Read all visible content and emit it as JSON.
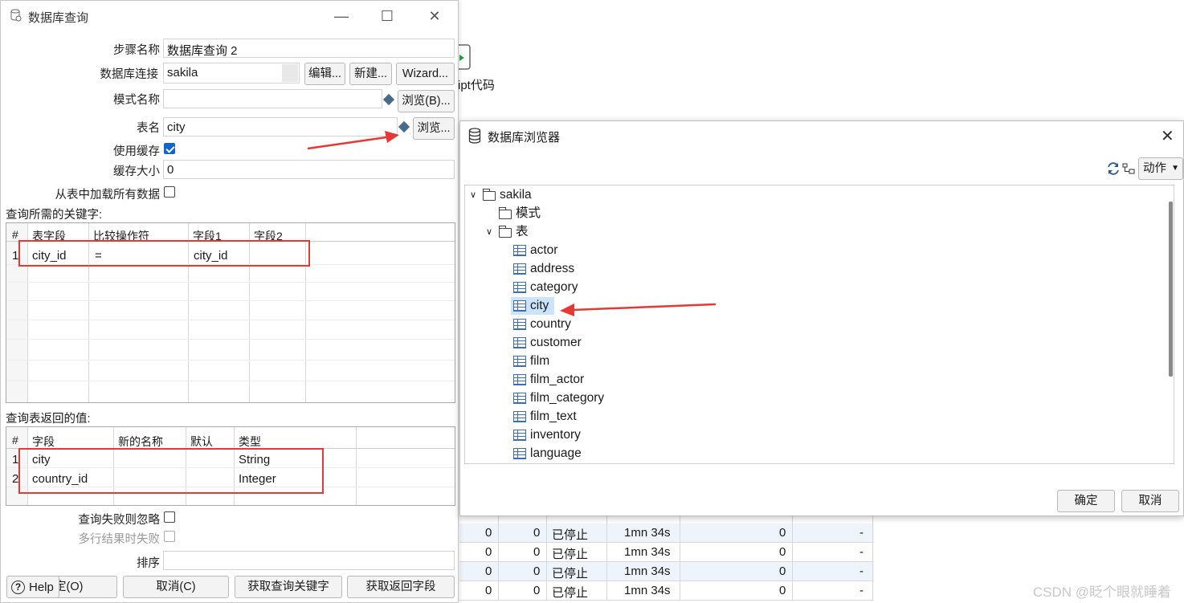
{
  "background": {
    "step_label": "ipt代码",
    "rows": [
      {
        "c1": "0",
        "c2": "0",
        "status": "已停止",
        "time": "1mn 34s",
        "c5": "0",
        "c6": "-"
      },
      {
        "c1": "0",
        "c2": "0",
        "status": "已停止",
        "time": "1mn 34s",
        "c5": "0",
        "c6": "-"
      },
      {
        "c1": "0",
        "c2": "0",
        "status": "已停止",
        "time": "1mn 34s",
        "c5": "0",
        "c6": "-"
      },
      {
        "c1": "0",
        "c2": "0",
        "status": "已停止",
        "time": "1mn 34s",
        "c5": "0",
        "c6": "-"
      }
    ],
    "watermark": "CSDN @眨个眼就睡着"
  },
  "query_dialog": {
    "title": "数据库查询",
    "step_name_label": "步骤名称",
    "step_name_value": "数据库查询 2",
    "connection_label": "数据库连接",
    "connection_value": "sakila",
    "edit_btn": "编辑...",
    "new_btn": "新建...",
    "wizard_btn": "Wizard...",
    "schema_label": "模式名称",
    "schema_value": "",
    "browse_b_btn": "浏览(B)...",
    "table_label": "表名",
    "table_value": "city",
    "browse_btn": "浏览...",
    "use_cache_label": "使用缓存",
    "cache_size_label": "缓存大小",
    "cache_size_value": "0",
    "load_all_label": "从表中加载所有数据",
    "keys_label": "查询所需的关键字:",
    "keys_headers": [
      "#",
      "表字段",
      "比较操作符",
      "字段1",
      "字段2"
    ],
    "keys_rows": [
      {
        "n": "1",
        "field": "city_id",
        "op": "=",
        "f1": "city_id",
        "f2": ""
      }
    ],
    "return_label": "查询表返回的值:",
    "return_headers": [
      "#",
      "字段",
      "新的名称",
      "默认",
      "类型"
    ],
    "return_rows": [
      {
        "n": "1",
        "field": "city",
        "name": "",
        "default": "",
        "type": "String"
      },
      {
        "n": "2",
        "field": "country_id",
        "name": "",
        "default": "",
        "type": "Integer"
      }
    ],
    "fail_ignore_label": "查询失败则忽略",
    "multi_fail_label": "多行结果时失败",
    "order_label": "排序",
    "order_value": "",
    "help_btn": "Help",
    "ok_btn": "定(O)",
    "cancel_btn": "取消(C)",
    "get_keys_btn": "获取查询关键字",
    "get_fields_btn": "获取返回字段"
  },
  "browser_dialog": {
    "title": "数据库浏览器",
    "action_btn": "动作",
    "root": "sakila",
    "schema_node": "模式",
    "tables_node": "表",
    "tables": [
      "actor",
      "address",
      "category",
      "city",
      "country",
      "customer",
      "film",
      "film_actor",
      "film_category",
      "film_text",
      "inventory",
      "language"
    ],
    "selected": "city",
    "ok_btn": "确定",
    "cancel_btn": "取消"
  }
}
